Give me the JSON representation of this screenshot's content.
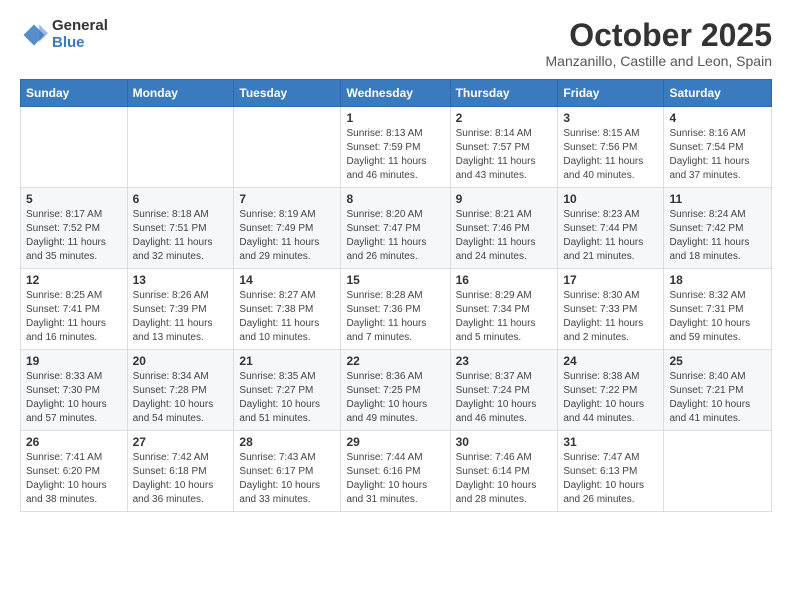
{
  "header": {
    "logo_general": "General",
    "logo_blue": "Blue",
    "month_title": "October 2025",
    "subtitle": "Manzanillo, Castille and Leon, Spain"
  },
  "days_of_week": [
    "Sunday",
    "Monday",
    "Tuesday",
    "Wednesday",
    "Thursday",
    "Friday",
    "Saturday"
  ],
  "weeks": [
    [
      {
        "day": "",
        "sunrise": "",
        "sunset": "",
        "daylight": ""
      },
      {
        "day": "",
        "sunrise": "",
        "sunset": "",
        "daylight": ""
      },
      {
        "day": "",
        "sunrise": "",
        "sunset": "",
        "daylight": ""
      },
      {
        "day": "1",
        "sunrise": "Sunrise: 8:13 AM",
        "sunset": "Sunset: 7:59 PM",
        "daylight": "Daylight: 11 hours and 46 minutes."
      },
      {
        "day": "2",
        "sunrise": "Sunrise: 8:14 AM",
        "sunset": "Sunset: 7:57 PM",
        "daylight": "Daylight: 11 hours and 43 minutes."
      },
      {
        "day": "3",
        "sunrise": "Sunrise: 8:15 AM",
        "sunset": "Sunset: 7:56 PM",
        "daylight": "Daylight: 11 hours and 40 minutes."
      },
      {
        "day": "4",
        "sunrise": "Sunrise: 8:16 AM",
        "sunset": "Sunset: 7:54 PM",
        "daylight": "Daylight: 11 hours and 37 minutes."
      }
    ],
    [
      {
        "day": "5",
        "sunrise": "Sunrise: 8:17 AM",
        "sunset": "Sunset: 7:52 PM",
        "daylight": "Daylight: 11 hours and 35 minutes."
      },
      {
        "day": "6",
        "sunrise": "Sunrise: 8:18 AM",
        "sunset": "Sunset: 7:51 PM",
        "daylight": "Daylight: 11 hours and 32 minutes."
      },
      {
        "day": "7",
        "sunrise": "Sunrise: 8:19 AM",
        "sunset": "Sunset: 7:49 PM",
        "daylight": "Daylight: 11 hours and 29 minutes."
      },
      {
        "day": "8",
        "sunrise": "Sunrise: 8:20 AM",
        "sunset": "Sunset: 7:47 PM",
        "daylight": "Daylight: 11 hours and 26 minutes."
      },
      {
        "day": "9",
        "sunrise": "Sunrise: 8:21 AM",
        "sunset": "Sunset: 7:46 PM",
        "daylight": "Daylight: 11 hours and 24 minutes."
      },
      {
        "day": "10",
        "sunrise": "Sunrise: 8:23 AM",
        "sunset": "Sunset: 7:44 PM",
        "daylight": "Daylight: 11 hours and 21 minutes."
      },
      {
        "day": "11",
        "sunrise": "Sunrise: 8:24 AM",
        "sunset": "Sunset: 7:42 PM",
        "daylight": "Daylight: 11 hours and 18 minutes."
      }
    ],
    [
      {
        "day": "12",
        "sunrise": "Sunrise: 8:25 AM",
        "sunset": "Sunset: 7:41 PM",
        "daylight": "Daylight: 11 hours and 16 minutes."
      },
      {
        "day": "13",
        "sunrise": "Sunrise: 8:26 AM",
        "sunset": "Sunset: 7:39 PM",
        "daylight": "Daylight: 11 hours and 13 minutes."
      },
      {
        "day": "14",
        "sunrise": "Sunrise: 8:27 AM",
        "sunset": "Sunset: 7:38 PM",
        "daylight": "Daylight: 11 hours and 10 minutes."
      },
      {
        "day": "15",
        "sunrise": "Sunrise: 8:28 AM",
        "sunset": "Sunset: 7:36 PM",
        "daylight": "Daylight: 11 hours and 7 minutes."
      },
      {
        "day": "16",
        "sunrise": "Sunrise: 8:29 AM",
        "sunset": "Sunset: 7:34 PM",
        "daylight": "Daylight: 11 hours and 5 minutes."
      },
      {
        "day": "17",
        "sunrise": "Sunrise: 8:30 AM",
        "sunset": "Sunset: 7:33 PM",
        "daylight": "Daylight: 11 hours and 2 minutes."
      },
      {
        "day": "18",
        "sunrise": "Sunrise: 8:32 AM",
        "sunset": "Sunset: 7:31 PM",
        "daylight": "Daylight: 10 hours and 59 minutes."
      }
    ],
    [
      {
        "day": "19",
        "sunrise": "Sunrise: 8:33 AM",
        "sunset": "Sunset: 7:30 PM",
        "daylight": "Daylight: 10 hours and 57 minutes."
      },
      {
        "day": "20",
        "sunrise": "Sunrise: 8:34 AM",
        "sunset": "Sunset: 7:28 PM",
        "daylight": "Daylight: 10 hours and 54 minutes."
      },
      {
        "day": "21",
        "sunrise": "Sunrise: 8:35 AM",
        "sunset": "Sunset: 7:27 PM",
        "daylight": "Daylight: 10 hours and 51 minutes."
      },
      {
        "day": "22",
        "sunrise": "Sunrise: 8:36 AM",
        "sunset": "Sunset: 7:25 PM",
        "daylight": "Daylight: 10 hours and 49 minutes."
      },
      {
        "day": "23",
        "sunrise": "Sunrise: 8:37 AM",
        "sunset": "Sunset: 7:24 PM",
        "daylight": "Daylight: 10 hours and 46 minutes."
      },
      {
        "day": "24",
        "sunrise": "Sunrise: 8:38 AM",
        "sunset": "Sunset: 7:22 PM",
        "daylight": "Daylight: 10 hours and 44 minutes."
      },
      {
        "day": "25",
        "sunrise": "Sunrise: 8:40 AM",
        "sunset": "Sunset: 7:21 PM",
        "daylight": "Daylight: 10 hours and 41 minutes."
      }
    ],
    [
      {
        "day": "26",
        "sunrise": "Sunrise: 7:41 AM",
        "sunset": "Sunset: 6:20 PM",
        "daylight": "Daylight: 10 hours and 38 minutes."
      },
      {
        "day": "27",
        "sunrise": "Sunrise: 7:42 AM",
        "sunset": "Sunset: 6:18 PM",
        "daylight": "Daylight: 10 hours and 36 minutes."
      },
      {
        "day": "28",
        "sunrise": "Sunrise: 7:43 AM",
        "sunset": "Sunset: 6:17 PM",
        "daylight": "Daylight: 10 hours and 33 minutes."
      },
      {
        "day": "29",
        "sunrise": "Sunrise: 7:44 AM",
        "sunset": "Sunset: 6:16 PM",
        "daylight": "Daylight: 10 hours and 31 minutes."
      },
      {
        "day": "30",
        "sunrise": "Sunrise: 7:46 AM",
        "sunset": "Sunset: 6:14 PM",
        "daylight": "Daylight: 10 hours and 28 minutes."
      },
      {
        "day": "31",
        "sunrise": "Sunrise: 7:47 AM",
        "sunset": "Sunset: 6:13 PM",
        "daylight": "Daylight: 10 hours and 26 minutes."
      },
      {
        "day": "",
        "sunrise": "",
        "sunset": "",
        "daylight": ""
      }
    ]
  ]
}
